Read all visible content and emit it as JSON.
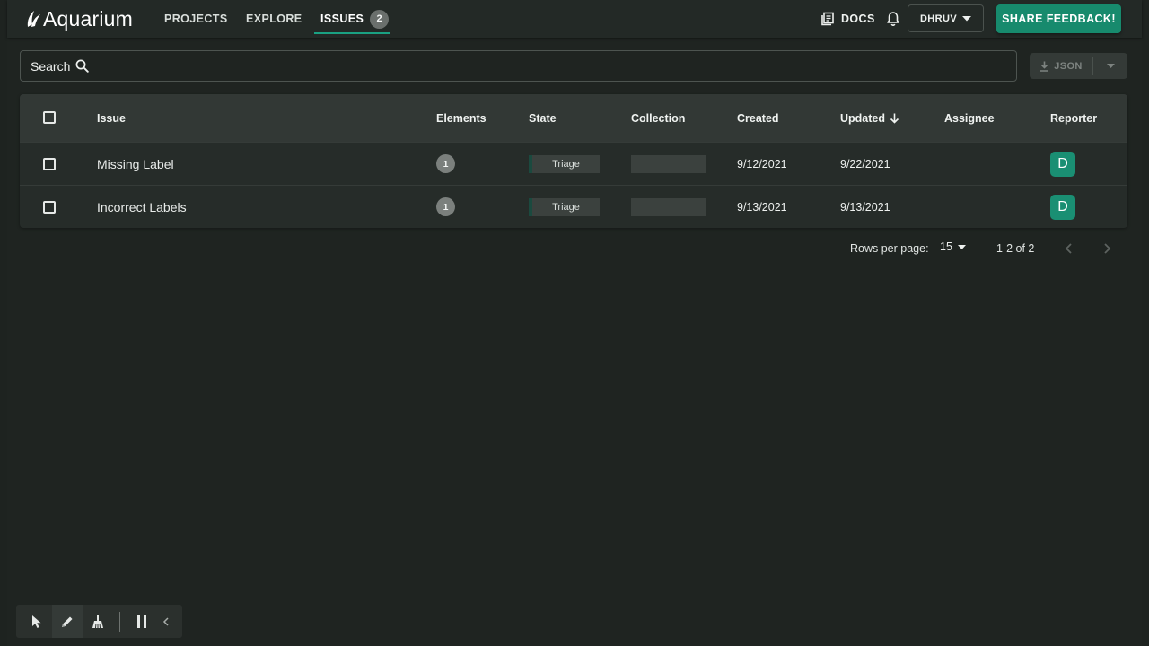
{
  "app": {
    "name": "Aquarium"
  },
  "nav": {
    "links": [
      {
        "label": "PROJECTS"
      },
      {
        "label": "EXPLORE"
      },
      {
        "label": "ISSUES",
        "count": "2"
      }
    ],
    "docs_label": "DOCS",
    "user_label": "DHRUV",
    "feedback_label": "SHARE FEEDBACK!"
  },
  "search": {
    "placeholder": "Search"
  },
  "export": {
    "json_label": "JSON"
  },
  "table": {
    "columns": [
      "Issue",
      "Elements",
      "State",
      "Collection",
      "Created",
      "Updated",
      "Assignee",
      "Reporter"
    ],
    "rows": [
      {
        "issue": "Missing Label",
        "elements": "1",
        "state": "Triage",
        "collection": "",
        "created": "9/12/2021",
        "updated": "9/22/2021",
        "assignee": "",
        "reporter": "D"
      },
      {
        "issue": "Incorrect Labels",
        "elements": "1",
        "state": "Triage",
        "collection": "",
        "created": "9/13/2021",
        "updated": "9/13/2021",
        "assignee": "",
        "reporter": "D"
      }
    ]
  },
  "pagination": {
    "rows_label": "Rows per page:",
    "rows_value": "15",
    "range": "1-2 of 2"
  },
  "colors": {
    "accent": "#178a6d",
    "background": "#1f2421",
    "avatar": "#1a8f73"
  }
}
